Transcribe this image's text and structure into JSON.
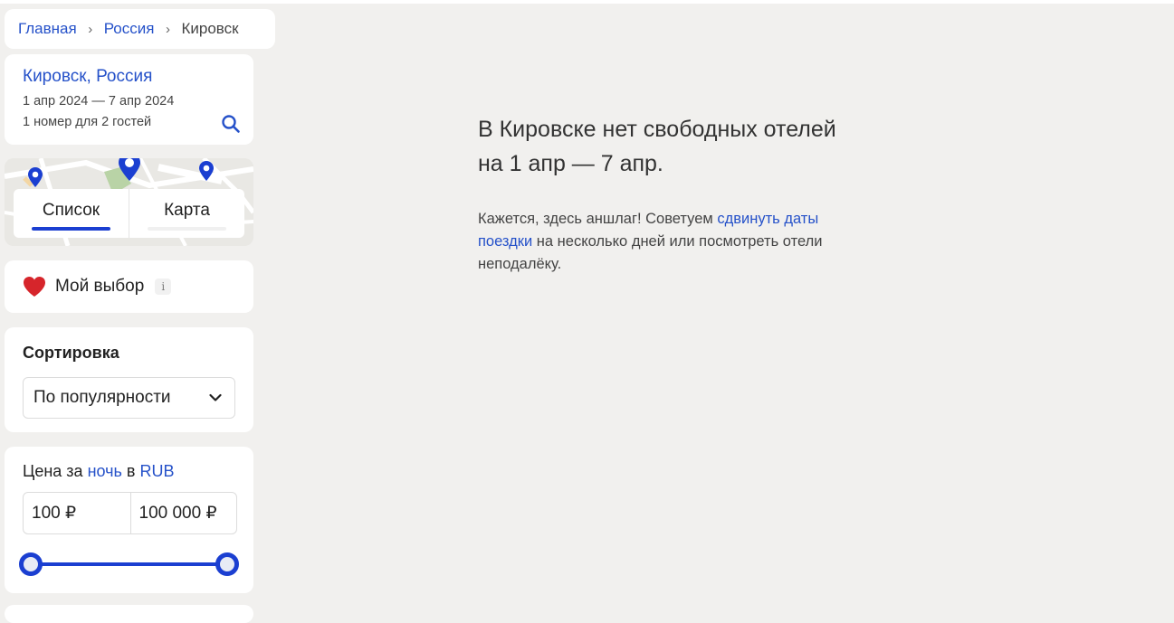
{
  "breadcrumb": {
    "items": [
      "Главная",
      "Россия"
    ],
    "current": "Кировск",
    "separator": "›"
  },
  "search_summary": {
    "place": "Кировск, Россия",
    "dates": "1 апр 2024 — 7 апр 2024",
    "guests": "1 номер для 2 гостей",
    "icon": "search-icon"
  },
  "view_toggle": {
    "list_label": "Список",
    "map_label": "Карта",
    "active": "list"
  },
  "favorites": {
    "label": "Мой выбор",
    "info_glyph": "i",
    "icon": "heart-icon"
  },
  "sorting": {
    "title": "Сортировка",
    "selected": "По популярности"
  },
  "price": {
    "title_prefix": "Цена за",
    "period_link": "ночь",
    "title_middle": "в",
    "currency_link": "RUB",
    "min_value": "100 ₽",
    "max_value": "100 000 ₽"
  },
  "message": {
    "headline": "В Кировске нет свободных отелей на 1 апр — 7 апр.",
    "text_before": "Кажется, здесь аншлаг! Советуем",
    "link": "сдвинуть даты поездки",
    "text_after": "на несколько дней или посмотреть отели неподалёку."
  },
  "colors": {
    "accent": "#2551c9",
    "slider": "#1b3fd1",
    "heart": "#d6252b",
    "background": "#f1f0ee"
  }
}
